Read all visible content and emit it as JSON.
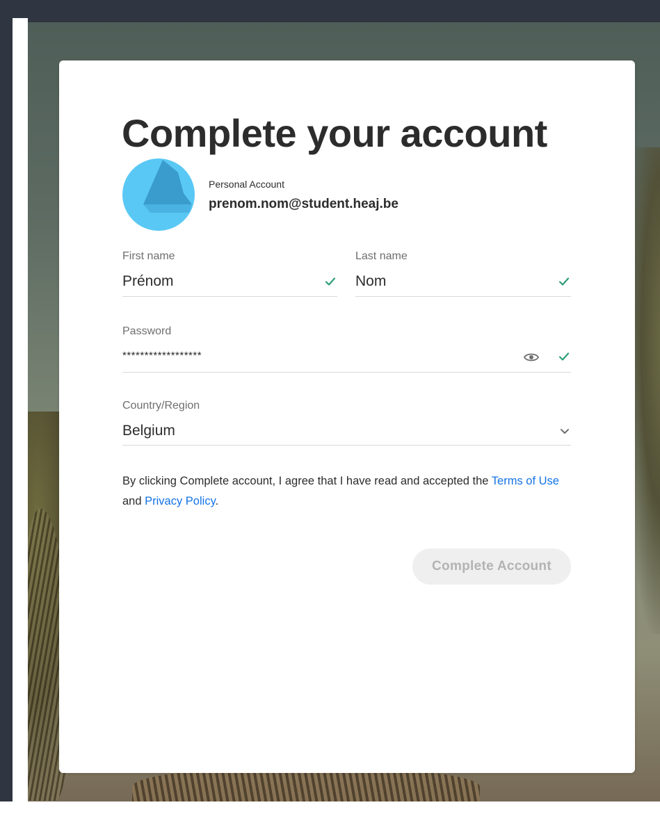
{
  "page": {
    "title": "Complete your account"
  },
  "account": {
    "type_label": "Personal Account",
    "email": "prenom.nom@student.heaj.be"
  },
  "form": {
    "first_name": {
      "label": "First name",
      "value": "Prénom"
    },
    "last_name": {
      "label": "Last name",
      "value": "Nom"
    },
    "password": {
      "label": "Password",
      "value": "******************"
    },
    "country": {
      "label": "Country/Region",
      "value": "Belgium"
    }
  },
  "terms": {
    "prefix": "By clicking Complete account, I agree that I have read and accepted the ",
    "terms_link": "Terms of Use",
    "middle": " and ",
    "privacy_link": "Privacy Policy",
    "suffix": "."
  },
  "submit": {
    "label": "Complete Account"
  },
  "colors": {
    "check": "#2d9d78",
    "link": "#1473e6",
    "avatar_light": "#5ac8f5",
    "avatar_dark": "#3a9ccc"
  },
  "icons": {
    "first_name_status": "check-icon",
    "last_name_status": "check-icon",
    "password_visibility": "eye-icon",
    "password_status": "check-icon",
    "country_dropdown": "chevron-down-icon"
  }
}
